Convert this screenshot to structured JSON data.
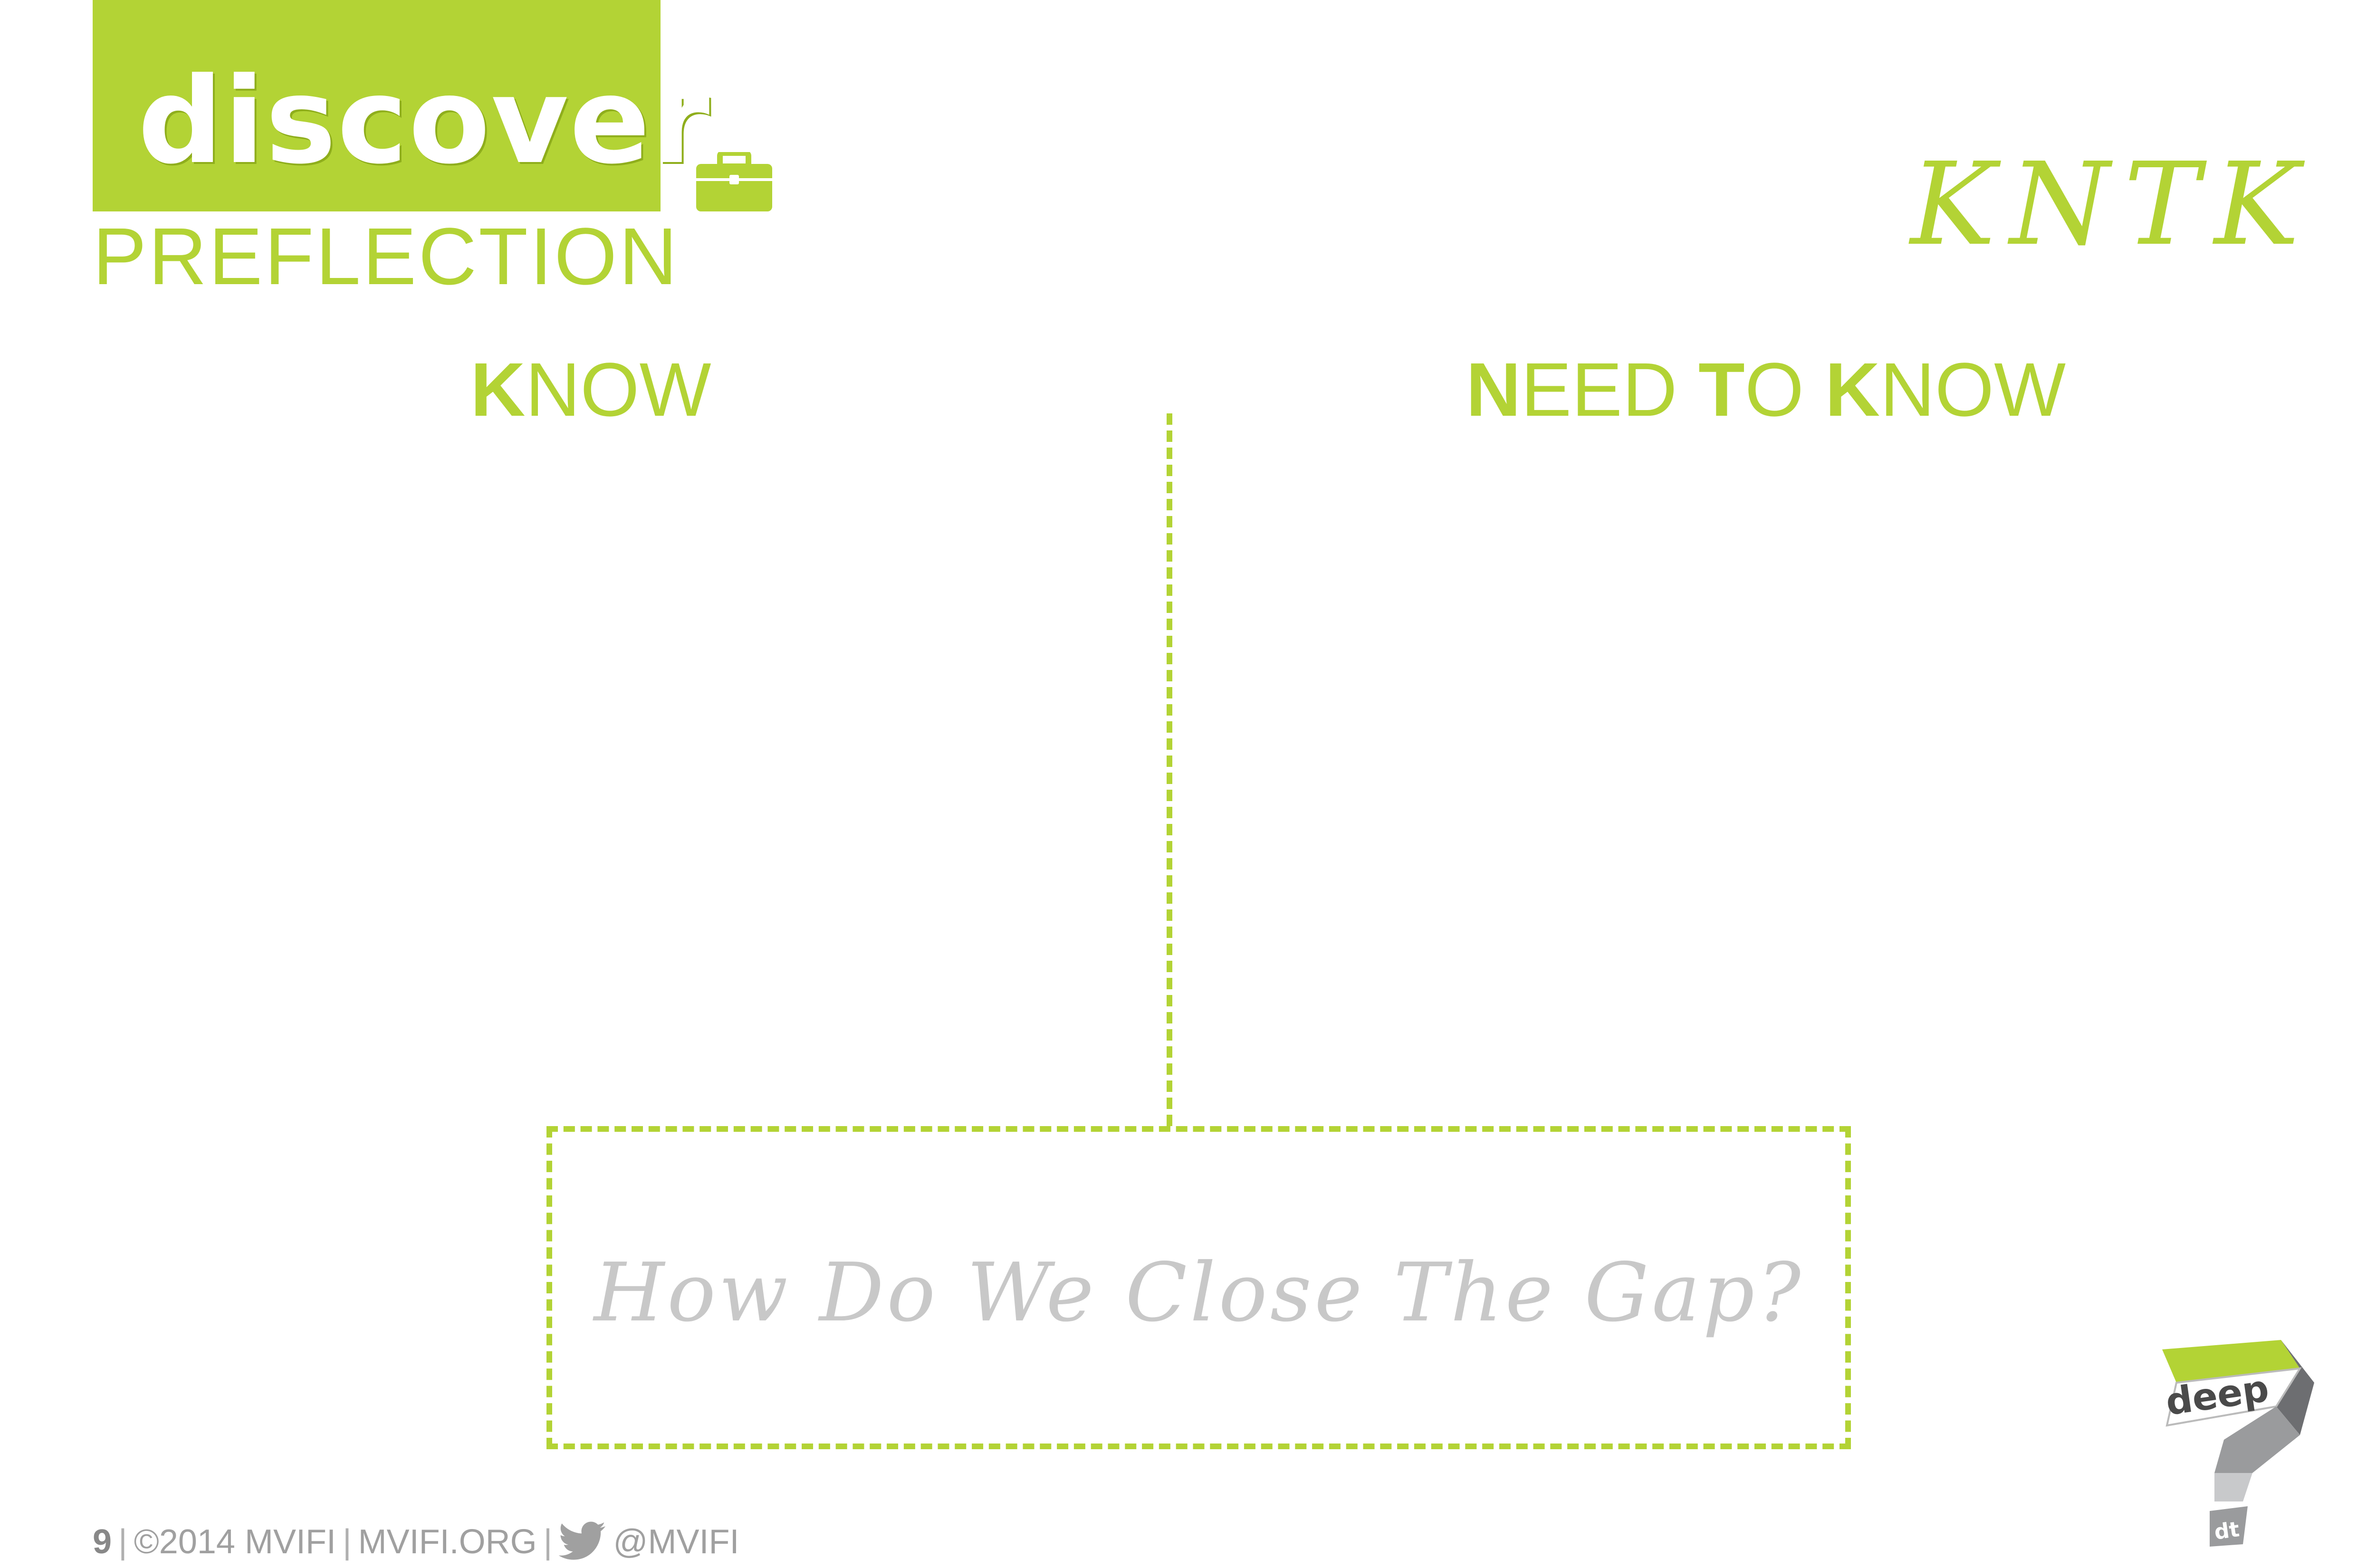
{
  "header": {
    "title": "discover",
    "subtitle": "PREFLECTION",
    "tag": "KNTK"
  },
  "columns": {
    "know": {
      "initial": "K",
      "rest": "NOW"
    },
    "need_to_know": {
      "w1_initial": "N",
      "w1_rest": "EED",
      "w2_initial": "T",
      "w2_rest": "O",
      "w3_initial": "K",
      "w3_rest": "NOW"
    }
  },
  "gap_box": {
    "prompt": "How Do We Close The Gap?"
  },
  "footer": {
    "page": "9",
    "copyright": "©2014 MVIFI",
    "site": "MVIFI.ORG",
    "handle": "@MVIFI",
    "separator": "|"
  },
  "logo": {
    "main": "deep",
    "sub": "dt"
  },
  "colors": {
    "accent": "#b3d335",
    "muted": "#a0a0a0",
    "prompt": "#c8c8c8"
  },
  "icons": [
    "briefcase-icon",
    "twitter-bird-icon"
  ]
}
